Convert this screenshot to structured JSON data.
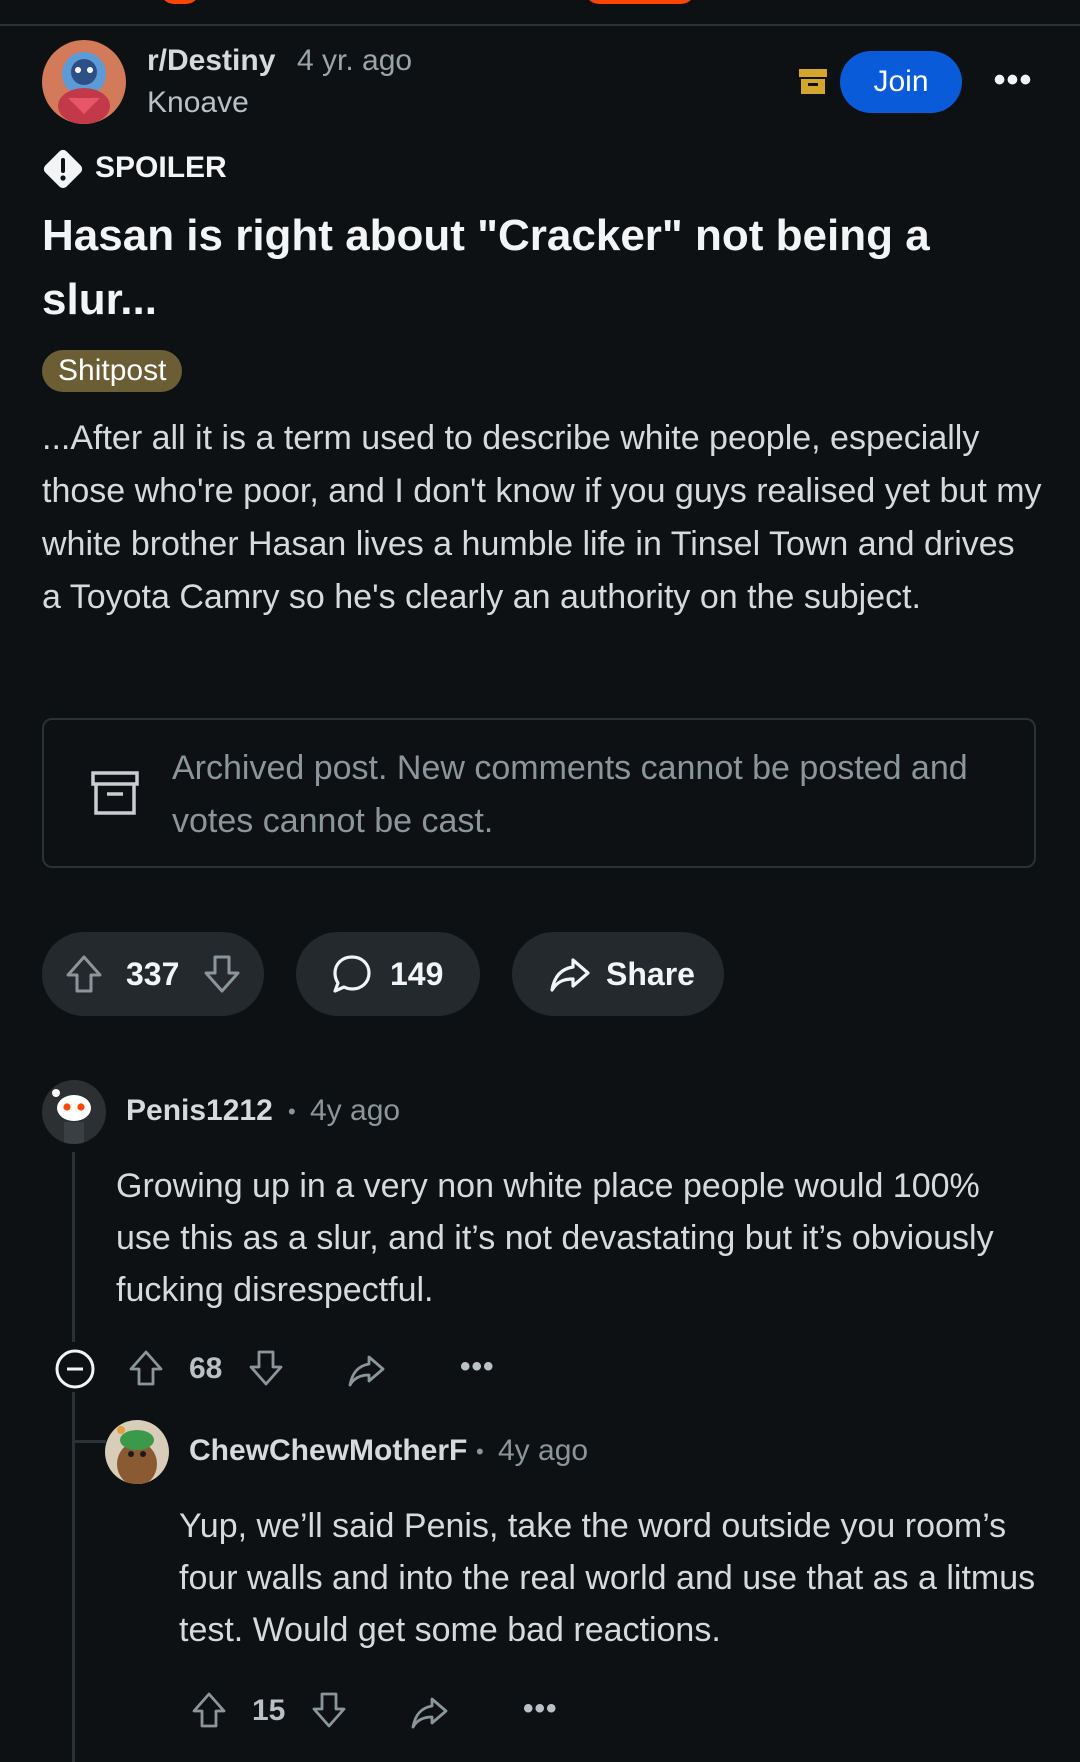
{
  "post": {
    "subreddit": "r/Destiny",
    "age": "4 yr. ago",
    "author": "Knoave",
    "join_label": "Join",
    "more_label": "•••",
    "spoiler_label": "SPOILER",
    "title": "Hasan is right about \"Cracker\" not being a slur...",
    "flair": "Shitpost",
    "body": "...After all it is a term used to describe white people, especially those who're poor, and I don't know if you guys realised yet but my white brother Hasan lives a humble life in Tinsel Town and drives a Toyota Camry so he's clearly an authority on the subject.",
    "archived_notice": "Archived post. New comments cannot be posted and votes cannot be cast.",
    "votes": "337",
    "comments": "149",
    "share_label": "Share"
  },
  "comments": [
    {
      "username": "Penis1212",
      "separator": "•",
      "age": "4y ago",
      "body": "Growing up in a very non white place people would 100% use this as a slur, and it’s not devastating but it’s obviously fucking disrespectful.",
      "votes": "68",
      "more_label": "•••"
    },
    {
      "username": "ChewChewMotherF",
      "separator": "•",
      "age": "4y ago",
      "body": "Yup, we’ll said Penis, take the word outside you room’s four walls and into the real world and use that as a litmus test. Would get some bad reactions.",
      "votes": "15",
      "more_label": "•••"
    }
  ],
  "colors": {
    "background": "#0e1113",
    "join_button": "#0a5bd9",
    "flair": "#6b5d34",
    "archive_icon": "#d4a72c",
    "pill": "#23292c"
  },
  "icons": {
    "archive": "archive-icon",
    "spoiler": "exclamation-icon",
    "upvote": "arrow-up-icon",
    "downvote": "arrow-down-icon",
    "comment": "speech-bubble-icon",
    "share": "share-arrow-icon",
    "collapse": "minus-circle-icon"
  }
}
